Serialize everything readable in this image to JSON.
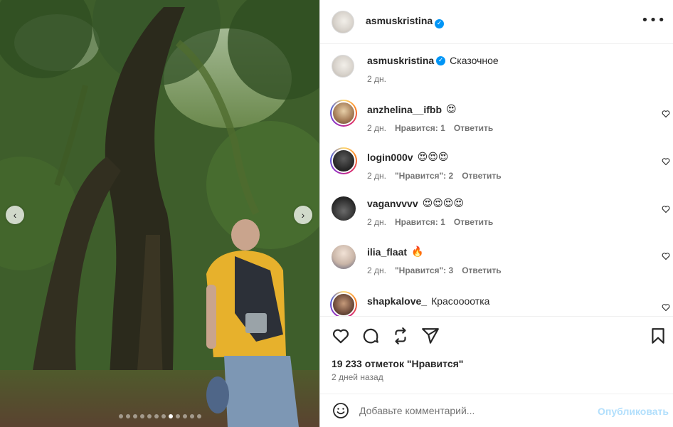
{
  "post": {
    "username": "asmuskristina",
    "caption": "Сказочное",
    "caption_time": "2 дн.",
    "more_icon": "more-horizontal-icon",
    "verified_icon": "verified-badge-icon"
  },
  "comments": [
    {
      "username": "anzhelina__ifbb",
      "text": "😍",
      "time": "2 дн.",
      "likes": "Нравится: 1",
      "reply": "Ответить"
    },
    {
      "username": "login000v",
      "text": "😍😍😍",
      "time": "2 дн.",
      "likes": "\"Нравится\": 2",
      "reply": "Ответить"
    },
    {
      "username": "vaganvvvv",
      "text": "😍😍😍😍",
      "time": "2 дн.",
      "likes": "Нравится: 1",
      "reply": "Ответить"
    },
    {
      "username": "ilia_flaat",
      "text": "🔥",
      "time": "2 дн.",
      "likes": "\"Нравится\": 3",
      "reply": "Ответить"
    },
    {
      "username": "shapkalove_",
      "text": "Красоооотка",
      "time": "",
      "likes": "",
      "reply": ""
    }
  ],
  "actions": {
    "likes_count": "19 233 отметок \"Нравится\"",
    "posted": "2 дней назад",
    "icons": [
      "heart-icon",
      "comment-icon",
      "repost-icon",
      "share-icon",
      "save-icon"
    ]
  },
  "add_comment": {
    "placeholder": "Добавьте комментарий...",
    "publish_label": "Опубликовать",
    "accent_color": "#0095f6"
  },
  "carousel": {
    "prev_glyph": "‹",
    "next_glyph": "›",
    "total_slides": 12,
    "active_slide": 8
  }
}
